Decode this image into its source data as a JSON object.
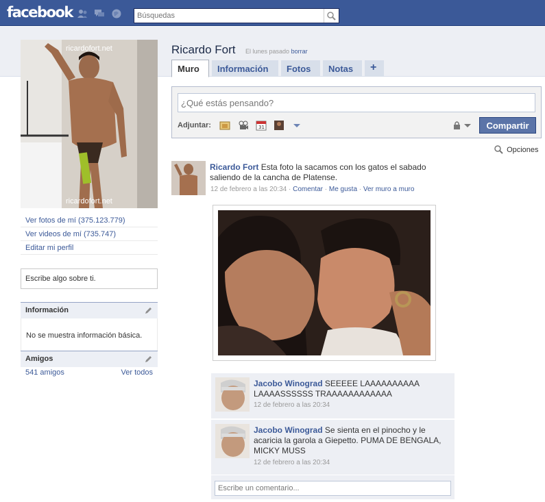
{
  "topbar": {
    "logo": "facebook",
    "search_placeholder": "Búsquedas",
    "icons": [
      "friends-icon",
      "messages-icon",
      "notifications-icon",
      "search-icon"
    ]
  },
  "profile": {
    "name": "Ricardo Fort",
    "last_update": "El lunes pasado",
    "delete_label": "borrar",
    "watermark": "ricardofort.net"
  },
  "tabs": [
    {
      "label": "Muro",
      "active": true
    },
    {
      "label": "Información",
      "active": false
    },
    {
      "label": "Fotos",
      "active": false
    },
    {
      "label": "Notas",
      "active": false
    },
    {
      "label": "+",
      "active": false
    }
  ],
  "left": {
    "links": [
      "Ver fotos de mí (375.123.779)",
      "Ver videos de mí (735.747)",
      "Editar mi perfil"
    ],
    "about_prompt": "Escribe algo sobre ti.",
    "info": {
      "title": "Información",
      "body": "No se muestra información básica."
    },
    "friends": {
      "title": "Amigos",
      "count": "541 amigos",
      "see_all": "Ver todos"
    }
  },
  "composer": {
    "placeholder": "¿Qué estás pensando?",
    "attach_label": "Adjuntar:",
    "share_label": "Compartir",
    "icons": [
      "photo-icon",
      "video-icon",
      "event-icon",
      "link-icon"
    ]
  },
  "options_label": "Opciones",
  "story": {
    "author": "Ricardo Fort",
    "text": "Esta foto la sacamos con los gatos el sabado saliendo de la cancha de Platense.",
    "time": "12 de febrero a las 20:34",
    "actions": [
      "Comentar",
      "Me gusta",
      "Ver muro a muro"
    ]
  },
  "comments": [
    {
      "author": "Jacobo Winograd",
      "text": "SEEEEE LAAAAAAAAAA LAAAASSSSSS TRAAAAAAAAAAAA",
      "time": "12 de febrero a las 20:34"
    },
    {
      "author": "Jacobo Winograd",
      "text": "Se sienta en el pinocho y le acaricia la garola a Giepetto. PUMA DE BENGALA, MICKY MUSS",
      "time": "12 de febrero a las 20:34"
    }
  ],
  "comment_placeholder": "Escribe un comentario...",
  "colors": {
    "brand": "#3b5998",
    "header_bg": "#edeff4",
    "share_button": "#5b74a8"
  }
}
